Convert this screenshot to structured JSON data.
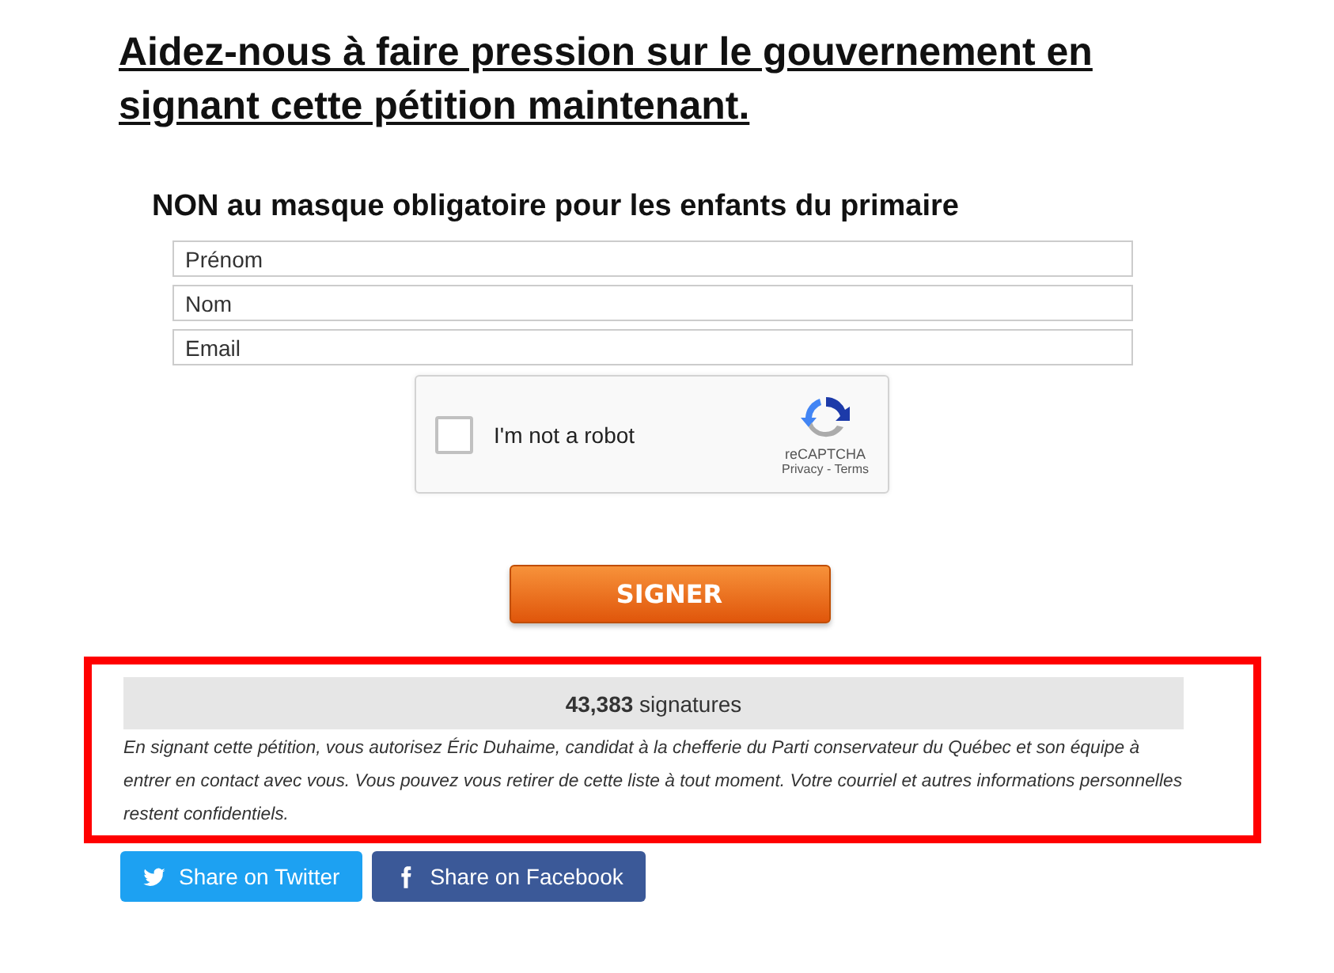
{
  "headline": "Aidez-nous à faire pression sur le gouvernement en signant cette pétition maintenant.",
  "petition_title": "NON au masque obligatoire pour les enfants du primaire",
  "fields": [
    {
      "placeholder": "Prénom"
    },
    {
      "placeholder": "Nom"
    },
    {
      "placeholder": "Email"
    }
  ],
  "captcha": {
    "label": "I'm not a robot",
    "checked": false,
    "brand": "reCAPTCHA",
    "privacy": "Privacy",
    "separator": "-",
    "terms": "Terms"
  },
  "submit_button": "SIGNER",
  "highlighted": true,
  "signatures": {
    "count": "43,383",
    "label": "signatures"
  },
  "disclaimer": "En signant cette pétition, vous autorisez Éric Duhaime, candidat à la chefferie du Parti conservateur du Québec et son équipe à entrer en contact avec vous. Vous pouvez vous retirer de cette liste à tout moment. Votre courriel et autres informations personnelles restent confidentiels.",
  "share_buttons": [
    {
      "kind": "twitter",
      "label": "Share on Twitter"
    },
    {
      "kind": "facebook",
      "label": "Share on Facebook"
    }
  ]
}
